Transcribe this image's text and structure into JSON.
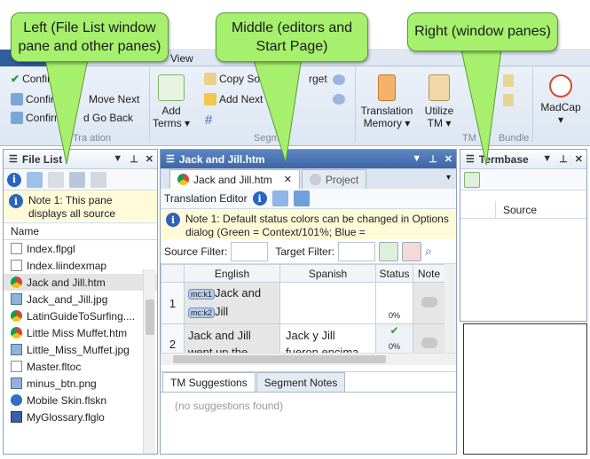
{
  "ribbon": {
    "view_tab": "View",
    "confirm": "Confirm",
    "confirm_move_next": "Confirm Move Next",
    "move_next": "Move Next",
    "confirm_go_back": "Confirm Go Back",
    "go_back": "d Go Back",
    "copy_source": "Copy Sourc",
    "target": "rget",
    "add_next_tag": "Add Next Ta",
    "add_terms": "Add\nTerms ▾",
    "translation_memory": "Translation\nMemory ▾",
    "utilize_tm": "Utilize\nTM ▾",
    "madcap": "MadCap\n▾",
    "group_translation": "Tra   ation",
    "group_segment": "Segm",
    "group_tm": "TM",
    "group_bundle": "Bundle"
  },
  "callouts": {
    "left": "Left (File List window pane and other panes)",
    "middle": "Middle (editors and Start Page)",
    "right": "Right (window panes)"
  },
  "file_list": {
    "title": "File List",
    "note": "Note 1: This pane displays all source",
    "column_header": "Name",
    "files": [
      {
        "name": "Index.flpgl",
        "icon": "page-icon"
      },
      {
        "name": "Index.liindexmap",
        "icon": "page-icon"
      },
      {
        "name": "Jack and Jill.htm",
        "icon": "chrome-icon",
        "selected": true
      },
      {
        "name": "Jack_and_Jill.jpg",
        "icon": "image-icon"
      },
      {
        "name": "LatinGuideToSurfing....",
        "icon": "chrome-icon"
      },
      {
        "name": "Little Miss Muffet.htm",
        "icon": "chrome-icon"
      },
      {
        "name": "Little_Miss_Muffet.jpg",
        "icon": "image-icon"
      },
      {
        "name": "Master.fltoc",
        "icon": "page-icon"
      },
      {
        "name": "minus_btn.png",
        "icon": "image-icon"
      },
      {
        "name": "Mobile Skin.flskn",
        "icon": "skin-icon"
      },
      {
        "name": "MyGlossary.flglo",
        "icon": "book-icon"
      }
    ]
  },
  "editor": {
    "title": "Jack and Jill.htm",
    "tab_active": "Jack and Jill.htm",
    "tab_inactive": "Project",
    "translation_editor_label": "Translation Editor",
    "note": "Note 1: Default status colors can be changed in Options dialog (Green = Context/101%; Blue =",
    "source_filter_label": "Source Filter:",
    "target_filter_label": "Target Filter:",
    "columns": [
      "English",
      "Spanish",
      "Status",
      "Note"
    ],
    "rows": [
      {
        "num": "1",
        "tags": [
          "mc:k1",
          "mc:k2"
        ],
        "source_lines": [
          "Jack and",
          "Jill"
        ],
        "target": "",
        "status": "0%"
      },
      {
        "num": "2",
        "source": "Jack and Jill went up the",
        "target": "Jack y Jill fueron encima",
        "status": "0%",
        "check": "✔"
      }
    ],
    "bottom_tabs": [
      "TM Suggestions",
      "Segment Notes"
    ],
    "no_suggestions": "(no suggestions found)"
  },
  "termbase": {
    "title": "Termbase",
    "column_header": "Source"
  },
  "colors": {
    "callout_green": "#a6f06d",
    "active_title_blue": "#3d67a5"
  }
}
